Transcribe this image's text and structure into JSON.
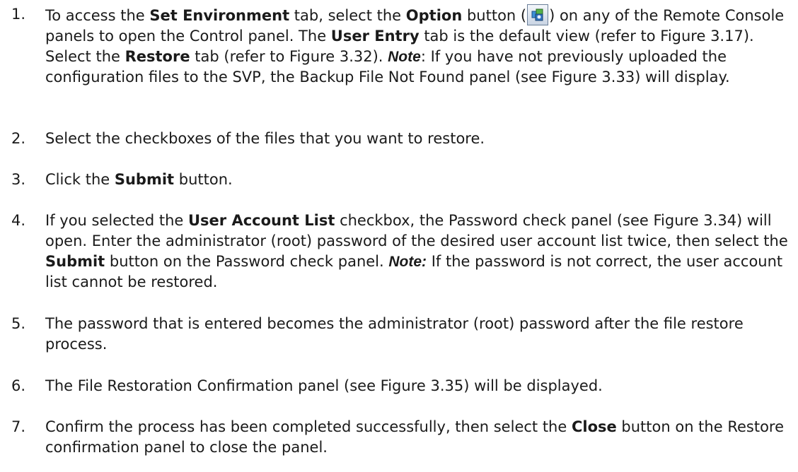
{
  "steps": [
    {
      "num": "1.",
      "t1": "To access the ",
      "b1": "Set Environment",
      "t2": " tab, select the ",
      "b2": "Option",
      "t3": " button (",
      "option_icon": "option-config-icon",
      "t4": ") on any of the Remote Console panels to open the Control panel. The ",
      "b3": "User Entry",
      "t5": " tab is the default view (refer to Figure 3.17). Select the ",
      "b4": "Restore",
      "t6": " tab (refer to Figure 3.32). ",
      "note": "Note",
      "t7": ": If you have not previously uploaded the configuration files to the SVP, the Backup File Not Found panel (see Figure 3.33) will display."
    },
    {
      "num": "2.",
      "t1": "Select the checkboxes of the files that you want to restore."
    },
    {
      "num": "3.",
      "t1": "Click the ",
      "b1": "Submit",
      "t2": " button."
    },
    {
      "num": "4.",
      "t1": "If you selected the ",
      "b1": "User Account List",
      "t2": " checkbox, the Password check panel (see Figure 3.34) will open. Enter the administrator (root) password of the desired user account list twice, then select the ",
      "b2": "Submit",
      "t3": " button on the Password check panel. ",
      "note": "Note:",
      "t4": " If the password is not correct, the user account list cannot be restored."
    },
    {
      "num": "5.",
      "t1": " The password that is entered becomes the administrator (root) password after the file restore process."
    },
    {
      "num": "6.",
      "t1": "The File Restoration Confirmation panel (see Figure 3.35) will be displayed."
    },
    {
      "num": "7.",
      "t1": "Confirm the process has been completed successfully, then select the ",
      "b1": "Close",
      "t2": " button on the Restore confirmation panel to close the panel."
    }
  ]
}
